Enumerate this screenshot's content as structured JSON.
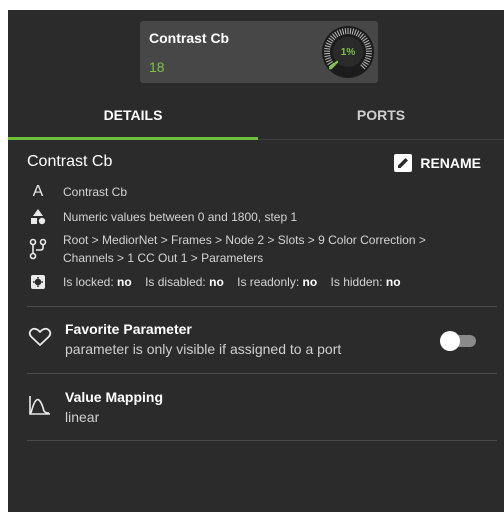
{
  "card": {
    "title": "Contrast Cb",
    "value": "18",
    "gauge_percent": "1%",
    "gauge_fraction": 0.01,
    "accent_color": "#7cc244"
  },
  "tabs": [
    {
      "label": "DETAILS",
      "active": true
    },
    {
      "label": "PORTS",
      "active": false
    }
  ],
  "detail": {
    "title": "Contrast Cb",
    "rename_label": "RENAME",
    "name": "Contrast Cb",
    "range": "Numeric values between 0 and 1800, step 1",
    "path": "Root > MediorNet > Frames > Node 2 > Slots > 9 Color Correction >",
    "path2": "Channels > 1 CC Out 1 > Parameters",
    "flags": {
      "locked_label": "Is locked:",
      "locked_value": "no",
      "disabled_label": "Is disabled:",
      "disabled_value": "no",
      "readonly_label": "Is readonly:",
      "readonly_value": "no",
      "hidden_label": "Is hidden:",
      "hidden_value": "no"
    }
  },
  "favorite": {
    "title": "Favorite Parameter",
    "description": "parameter is only visible if assigned to a port",
    "enabled": false
  },
  "mapping": {
    "title": "Value Mapping",
    "value": "linear"
  },
  "icons": {
    "name": "font-a-icon",
    "range": "shapes-icon",
    "path": "tree-path-icon",
    "flags": "chip-icon",
    "favorite": "heart-outline-icon",
    "mapping": "curve-icon",
    "rename": "pencil-icon"
  }
}
